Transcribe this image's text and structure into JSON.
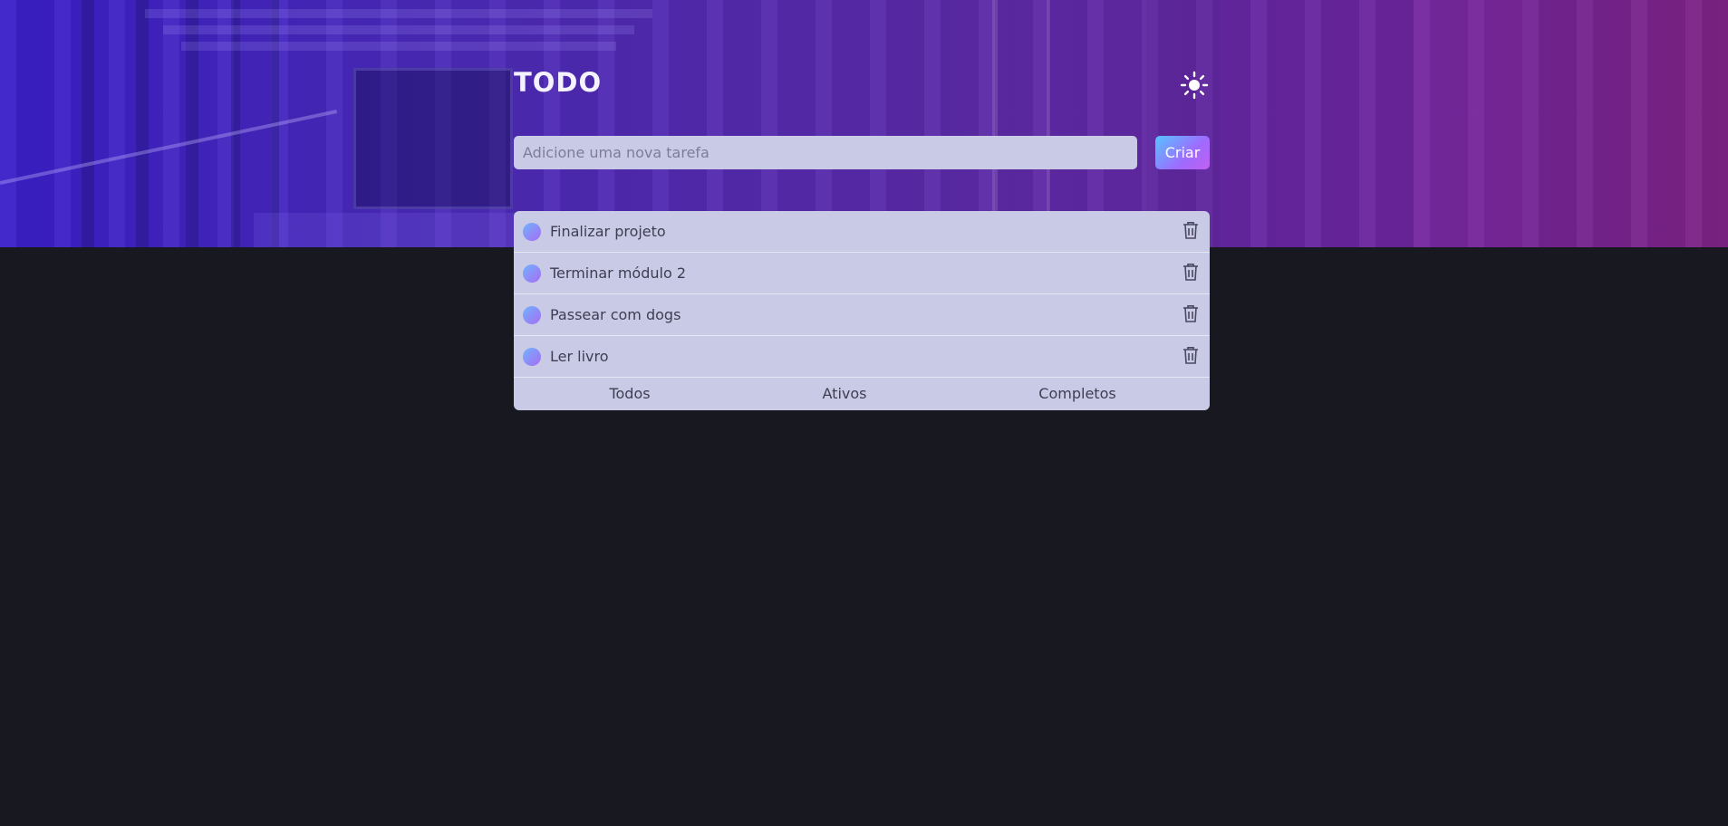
{
  "app": {
    "title": "TODO",
    "theme_toggle_icon": "sun-icon"
  },
  "new_task": {
    "placeholder": "Adicione uma nova tarefa",
    "value": "",
    "create_label": "Criar"
  },
  "tasks": [
    {
      "label": "Finalizar projeto",
      "completed": false
    },
    {
      "label": "Terminar módulo 2",
      "completed": false
    },
    {
      "label": "Passear com dogs",
      "completed": false
    },
    {
      "label": "Ler livro",
      "completed": false
    }
  ],
  "filters": [
    {
      "label": "Todos"
    },
    {
      "label": "Ativos"
    },
    {
      "label": "Completos"
    }
  ],
  "colors": {
    "background": "#181820",
    "panel": "#c9cbe6",
    "accent_start": "#57c3ff",
    "accent_end": "#c060f0",
    "hero_start": "#3b1fc9",
    "hero_end": "#7e2385"
  }
}
